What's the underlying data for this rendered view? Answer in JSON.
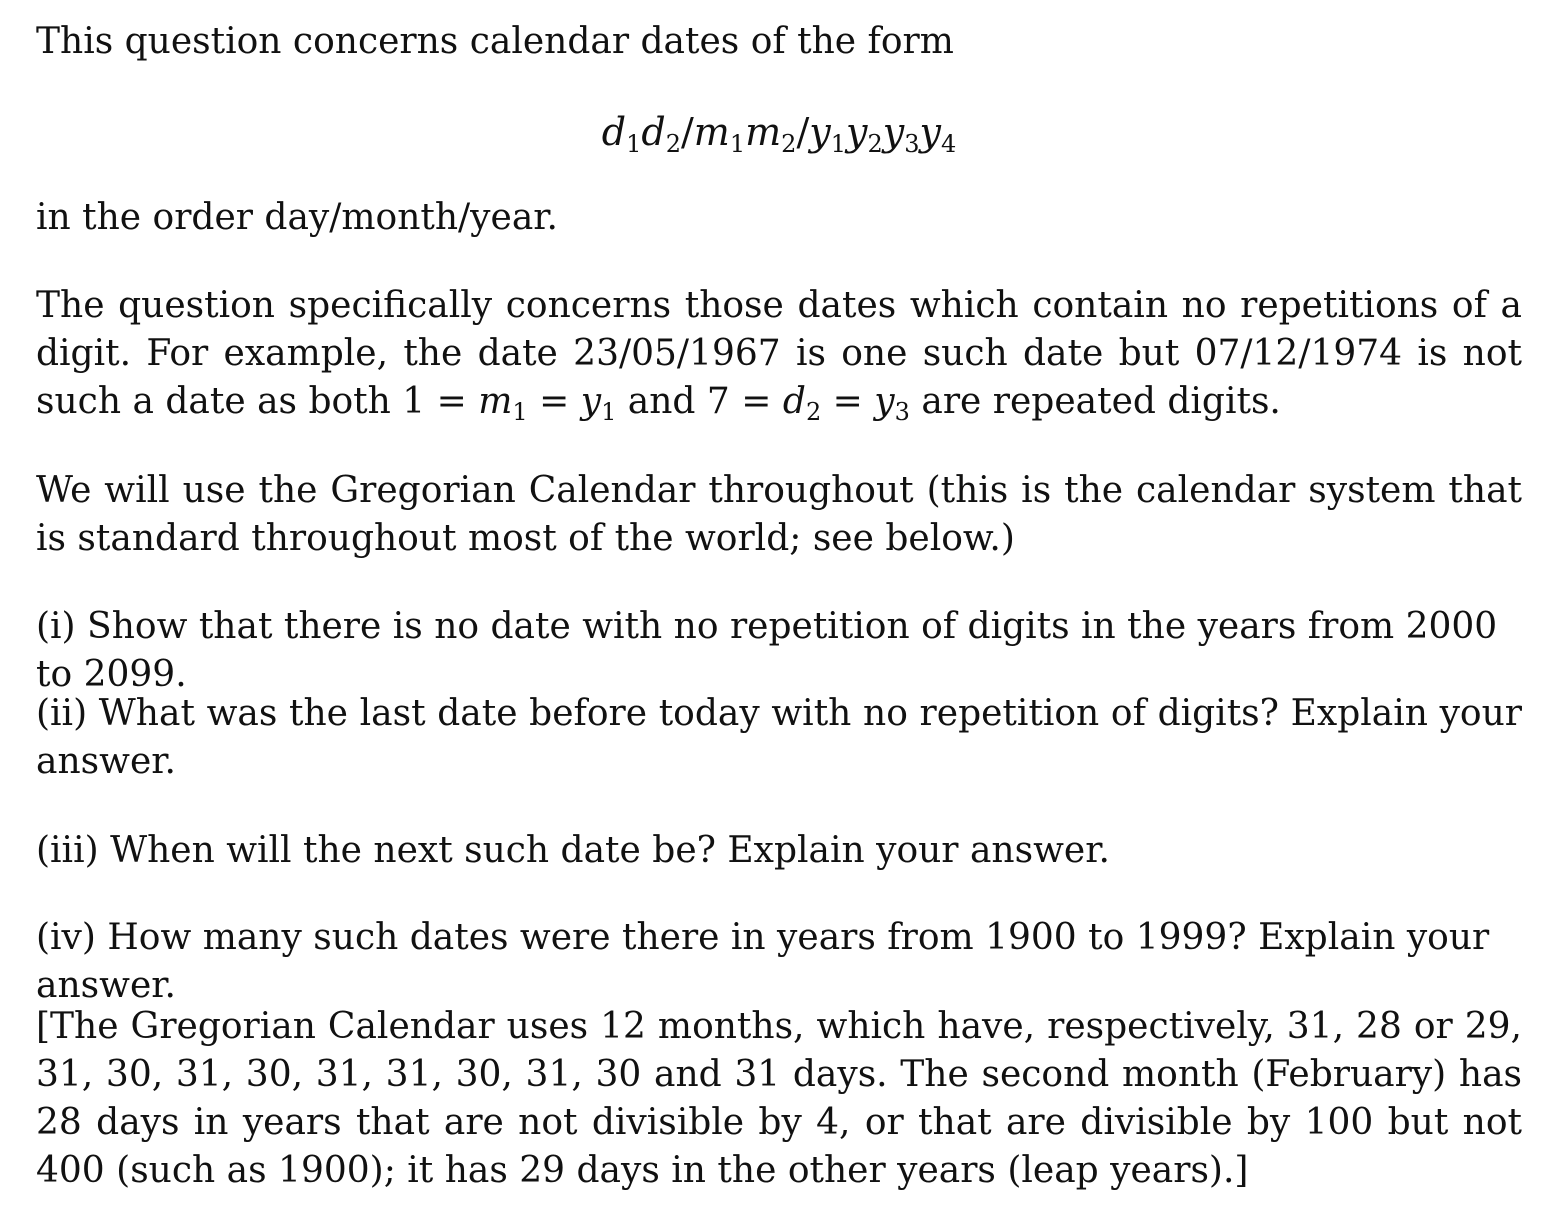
{
  "intro": {
    "line1": "This question concerns calendar dates of the form",
    "formula": {
      "d": "d",
      "m": "m",
      "y": "y",
      "s1": "1",
      "s2": "2",
      "s3": "3",
      "s4": "4",
      "slash": "/"
    },
    "line2": "in the order day/month/year."
  },
  "para_repetitions": {
    "text_a": "The question specifically concerns those dates which contain no repetitions of a digit. For example, the date 23/05/1967 is one such date but 07/12/1974 is not such a date as both 1 = ",
    "m": "m",
    "one": "1",
    "eq": " = ",
    "y": "y",
    "and_seven": " and 7 = ",
    "d": "d",
    "two": "2",
    "three": "3",
    "text_end": " are repeated digits."
  },
  "para_gregorian": "We will use the Gregorian Calendar throughout (this is the calendar system that is standard throughout most of the world; see below.)",
  "questions": [
    "(i) Show that there is no date with no repetition of digits in the years from 2000 to 2099.",
    "(ii) What was the last date before today with no repetition of digits?  Explain your answer.",
    "(iii) When will the next such date be? Explain your answer.",
    "(iv) How many such dates were there in years from 1900 to 1999? Explain your answer."
  ],
  "note": "[The Gregorian Calendar uses 12 months, which have, respectively, 31, 28 or 29, 31, 30, 31, 30, 31, 31, 30, 31, 30 and 31 days.  The second month (February) has 28 days in years that are not divisible by 4, or that are divisible by 100 but not 400 (such as 1900); it has 29 days in the other years (leap years).]"
}
